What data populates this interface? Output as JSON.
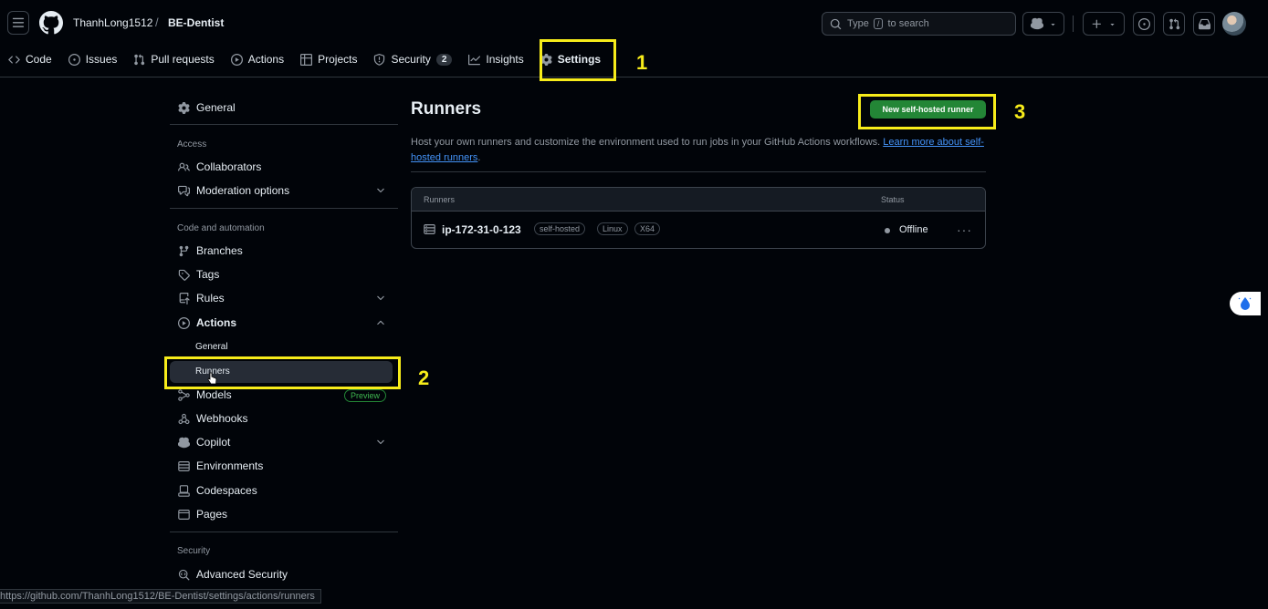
{
  "header": {
    "owner": "ThanhLong1512",
    "separator": "/",
    "repo": "BE-Dentist",
    "search_prefix": "Type",
    "search_key": "/",
    "search_suffix": "to search"
  },
  "tabs": [
    {
      "label": "Code",
      "icon": "code-icon"
    },
    {
      "label": "Issues",
      "icon": "issue-icon"
    },
    {
      "label": "Pull requests",
      "icon": "pull-request-icon"
    },
    {
      "label": "Actions",
      "icon": "play-icon"
    },
    {
      "label": "Projects",
      "icon": "table-icon"
    },
    {
      "label": "Security",
      "icon": "shield-icon",
      "counter": "2"
    },
    {
      "label": "Insights",
      "icon": "graph-icon"
    },
    {
      "label": "Settings",
      "icon": "gear-icon",
      "active": true
    }
  ],
  "annotations": {
    "one": "1",
    "two": "2",
    "three": "3"
  },
  "sidebar": {
    "general": "General",
    "access_heading": "Access",
    "collaborators": "Collaborators",
    "moderation": "Moderation options",
    "code_heading": "Code and automation",
    "branches": "Branches",
    "tags": "Tags",
    "rules": "Rules",
    "actions": "Actions",
    "actions_general": "General",
    "actions_runners": "Runners",
    "models": "Models",
    "models_badge": "Preview",
    "webhooks": "Webhooks",
    "copilot": "Copilot",
    "environments": "Environments",
    "codespaces": "Codespaces",
    "pages": "Pages",
    "security_heading": "Security",
    "advanced_security": "Advanced Security"
  },
  "main": {
    "title": "Runners",
    "new_button": "New self-hosted runner",
    "desc_text": "Host your own runners and customize the environment used to run jobs in your GitHub Actions workflows. ",
    "desc_link": "Learn more about self-hosted runners",
    "desc_end": ".",
    "table": {
      "col_runners": "Runners",
      "col_status": "Status",
      "rows": [
        {
          "name": "ip-172-31-0-123",
          "labels": [
            "self-hosted",
            "Linux",
            "X64"
          ],
          "status": "Offline"
        }
      ]
    }
  },
  "statusbar": "https://github.com/ThanhLong1512/BE-Dentist/settings/actions/runners"
}
